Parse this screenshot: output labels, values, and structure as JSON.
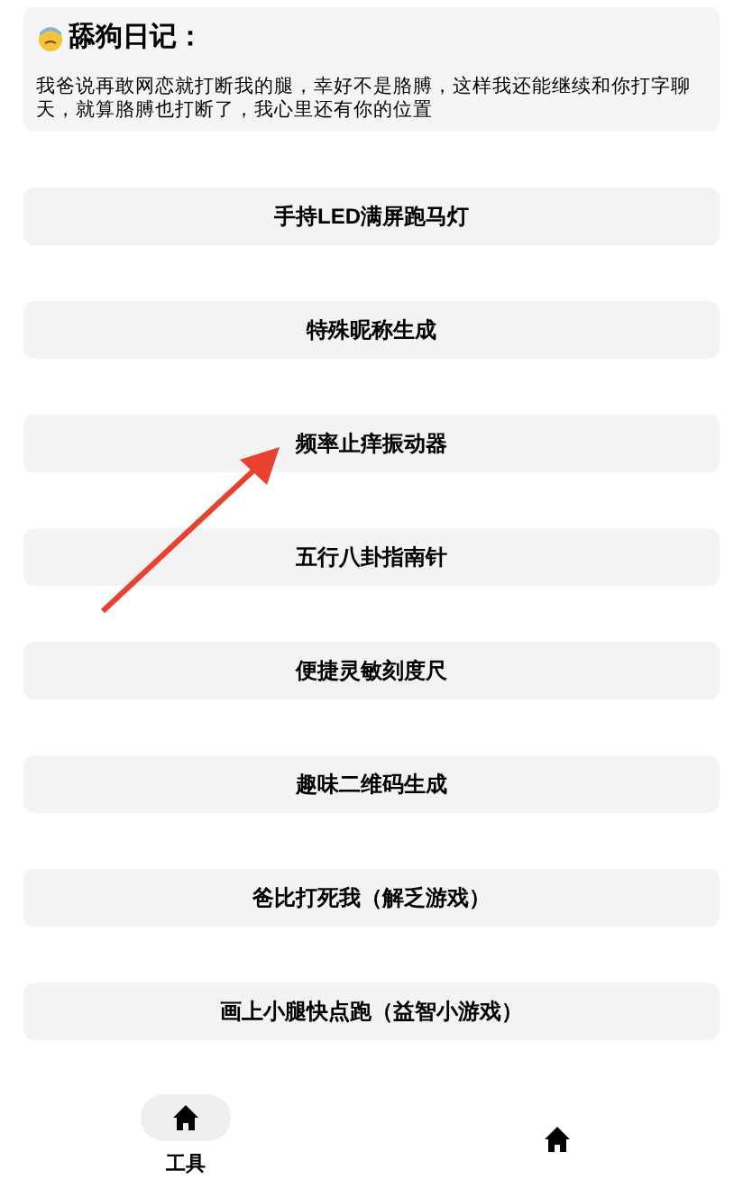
{
  "diary": {
    "title": "舔狗日记：",
    "text": "我爸说再敢网恋就打断我的腿，幸好不是胳膊，这样我还能继续和你打字聊天，就算胳膊也打断了，我心里还有你的位置"
  },
  "tools": [
    {
      "label": "手持LED满屏跑马灯"
    },
    {
      "label": "特殊昵称生成"
    },
    {
      "label": "频率止痒振动器"
    },
    {
      "label": "五行八卦指南针"
    },
    {
      "label": "便捷灵敏刻度尺"
    },
    {
      "label": "趣味二维码生成"
    },
    {
      "label": "爸比打死我（解乏游戏）"
    },
    {
      "label": "画上小腿快点跑（益智小游戏）"
    }
  ],
  "bottom_nav": [
    {
      "label": "工具",
      "selected": true
    },
    {
      "selected": false
    }
  ]
}
